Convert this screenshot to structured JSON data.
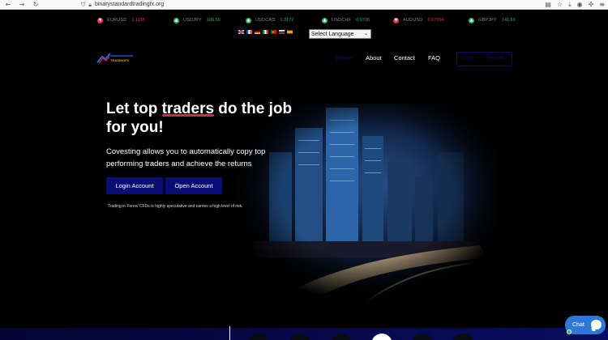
{
  "browser": {
    "url": "binarystandardtradingfx.org",
    "icons": [
      "back-icon",
      "forward-icon",
      "reload-icon",
      "shield-icon",
      "lock-icon",
      "reader-icon",
      "star-icon",
      "download-icon",
      "account-icon",
      "extensions-icon",
      "menu-icon"
    ]
  },
  "ticker": [
    {
      "symbol": "EURUSD",
      "value": "1.1155",
      "trend": "down"
    },
    {
      "symbol": "USDJPY",
      "value": "109.59",
      "trend": "up"
    },
    {
      "symbol": "USDCAD",
      "value": "1.3172",
      "trend": "up"
    },
    {
      "symbol": "USDCHF",
      "value": "0.9776",
      "trend": "up"
    },
    {
      "symbol": "AUDUSD",
      "value": "0.67064",
      "trend": "down"
    },
    {
      "symbol": "GBPJPY",
      "value": "141.91",
      "trend": "up"
    }
  ],
  "language": {
    "select_label": "Select Language",
    "flags": [
      "english",
      "french",
      "german",
      "italian",
      "portuguese",
      "russian",
      "spanish"
    ]
  },
  "header": {
    "logo_text": "TRADINGFX",
    "nav": {
      "home": "Home",
      "about": "About",
      "contact": "Contact",
      "faq": "FAQ"
    },
    "login": "Login",
    "register": "Register"
  },
  "hero": {
    "title_pre": "Let top ",
    "title_highlight": "traders",
    "title_post": " do the job for you!",
    "subtitle": "Covesting allows you to automatically copy top performing traders and achieve the returns",
    "login_button": "Login Account",
    "open_button": "Open Account",
    "disclaimer": "Trading in Forex/ CFDs is highly speculative and carries a high level of risk."
  },
  "chat": {
    "label": "Chat"
  },
  "colors": {
    "down": "#e6374d",
    "up": "#2fb56a",
    "button_bg": "#0a0d73",
    "highlight": "#d92a46",
    "chat": "#2d79d6"
  }
}
